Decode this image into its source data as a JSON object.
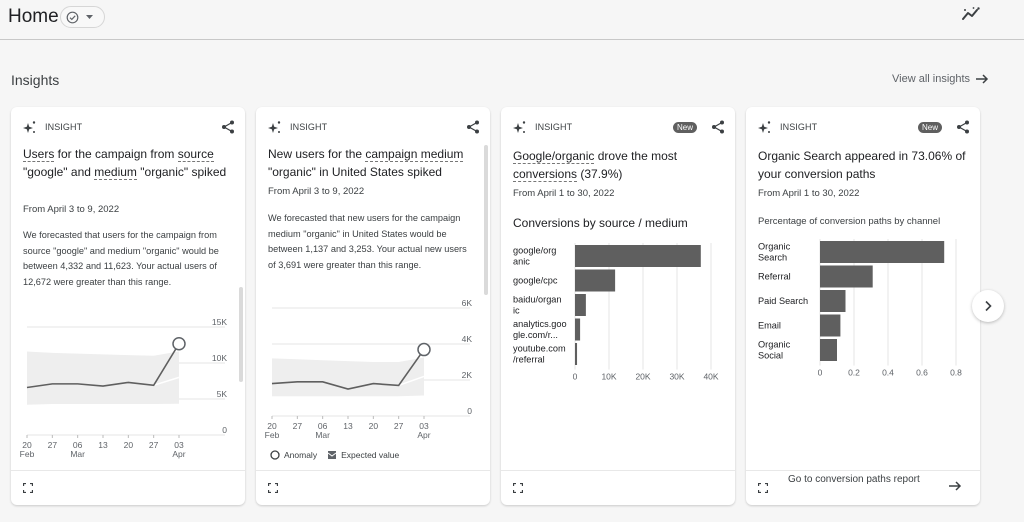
{
  "header": {
    "title": "Home",
    "status_icon": "check-circle-icon",
    "dropdown_icon": "caret-down-icon",
    "insights_icon": "sparkle-trend-icon"
  },
  "section": {
    "title": "Insights",
    "view_all": "View all insights"
  },
  "colors": {
    "bar": "#5f5f5f",
    "line": "#5f5f5f",
    "band": "#eeeeee",
    "grid": "#e4e4e4",
    "badge": "#5f5f5f"
  },
  "cards": [
    {
      "label": "INSIGHT",
      "badge": null,
      "title_parts": [
        "Users",
        " for the campaign from ",
        "source",
        " \"google\" and ",
        "medium",
        " \"organic\" spiked"
      ],
      "date": "From April 3 to 9, 2022",
      "description": "We forecasted that users for the campaign from source \"google\" and medium \"organic\" would be between 4,332 and 11,623. Your actual users of 12,672 were greater than this range."
    },
    {
      "label": "INSIGHT",
      "badge": null,
      "title_parts": [
        "New users for the ",
        "campaign medium",
        " \"organic\" in United States spiked"
      ],
      "date": "From April 3 to 9, 2022",
      "description": "We forecasted that new users for the campaign medium \"organic\" in United States would be between 1,137 and 3,253. Your actual new users of 3,691 were greater than this range.",
      "legend": {
        "anomaly": "Anomaly",
        "expected": "Expected value"
      }
    },
    {
      "label": "INSIGHT",
      "badge": "New",
      "title_parts": [
        "Google/organic",
        " drove the most ",
        "conversions",
        " (37.9%)"
      ],
      "date": "From April 1 to 30, 2022",
      "subhead": "Conversions by source / medium"
    },
    {
      "label": "INSIGHT",
      "badge": "New",
      "title_parts": [
        "Organic Search appeared in 73.06% of your conversion paths"
      ],
      "date": "From April 1 to 30, 2022",
      "subhead": "Percentage of conversion paths by channel",
      "footer_link": "Go to conversion paths report"
    }
  ],
  "chart_data": [
    {
      "type": "line",
      "title": "Users",
      "x": [
        "20 Feb",
        "27",
        "06 Mar",
        "13",
        "20",
        "27",
        "03 Apr"
      ],
      "xtick_top": [
        "20",
        "27",
        "06",
        "13",
        "20",
        "27",
        "03"
      ],
      "xtick_bottom": [
        "Feb",
        "",
        "Mar",
        "",
        "",
        "",
        "Apr"
      ],
      "series": [
        {
          "name": "Users",
          "values": [
            6600,
            7100,
            7100,
            6800,
            7300,
            6900,
            12672
          ]
        }
      ],
      "expected_band": {
        "lower": [
          4200,
          4300,
          4300,
          4300,
          4300,
          4300,
          4332
        ],
        "upper": [
          11600,
          11400,
          11300,
          11200,
          11100,
          11000,
          11623
        ]
      },
      "expected_value_last": 8000,
      "anomaly_index": 6,
      "yticks": [
        "0",
        "5K",
        "10K",
        "15K"
      ],
      "ylim": [
        0,
        15000
      ],
      "grid": true
    },
    {
      "type": "line",
      "title": "New users",
      "x": [
        "20 Feb",
        "27",
        "06 Mar",
        "13",
        "20",
        "27",
        "03 Apr"
      ],
      "xtick_top": [
        "20",
        "27",
        "06",
        "13",
        "20",
        "27",
        "03"
      ],
      "xtick_bottom": [
        "Feb",
        "",
        "Mar",
        "",
        "",
        "",
        "Apr"
      ],
      "series": [
        {
          "name": "New users",
          "values": [
            1800,
            1900,
            1900,
            1500,
            1800,
            1700,
            3691
          ]
        }
      ],
      "expected_band": {
        "lower": [
          1100,
          1100,
          1100,
          1100,
          1100,
          1100,
          1137
        ],
        "upper": [
          3200,
          3150,
          3100,
          3050,
          3000,
          3000,
          3253
        ]
      },
      "expected_value_last": 2200,
      "anomaly_index": 6,
      "yticks": [
        "0",
        "2K",
        "4K",
        "6K"
      ],
      "ylim": [
        0,
        6000
      ],
      "grid": true
    },
    {
      "type": "bar",
      "orientation": "horizontal",
      "title": "Conversions by source / medium",
      "categories": [
        [
          "google/org",
          "anic"
        ],
        [
          "google/cpc"
        ],
        [
          "baidu/organ",
          "ic"
        ],
        [
          "analytics.goo",
          "gle.com/r..."
        ],
        [
          "youtube.com",
          "/referral"
        ]
      ],
      "values": [
        37000,
        11800,
        3200,
        1500,
        600
      ],
      "xticks": [
        "0",
        "10K",
        "20K",
        "30K",
        "40K"
      ],
      "xlim": [
        0,
        40000
      ],
      "grid": true
    },
    {
      "type": "bar",
      "orientation": "horizontal",
      "title": "Percentage of conversion paths by channel",
      "categories": [
        [
          "Organic",
          "Search"
        ],
        [
          "Referral"
        ],
        [
          "Paid Search"
        ],
        [
          "Email"
        ],
        [
          "Organic",
          "Social"
        ]
      ],
      "values": [
        0.7306,
        0.31,
        0.15,
        0.12,
        0.1
      ],
      "xticks": [
        "0",
        "0.2",
        "0.4",
        "0.6",
        "0.8"
      ],
      "xlim": [
        0,
        0.8
      ],
      "grid": true
    }
  ]
}
